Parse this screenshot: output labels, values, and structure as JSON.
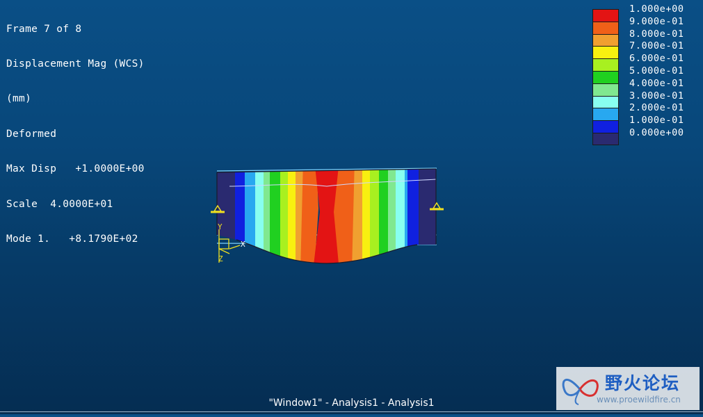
{
  "info_lines": [
    "Frame 7 of 8",
    "Displacement Mag (WCS)",
    "(mm)",
    "Deformed",
    "Max Disp   +1.0000E+00",
    "Scale  4.0000E+01",
    "Mode 1.   +8.1790E+02"
  ],
  "legend": [
    {
      "label": "1.000e+00",
      "color": "#e31414"
    },
    {
      "label": "9.000e-01",
      "color": "#f06018"
    },
    {
      "label": "8.000e-01",
      "color": "#f0a030"
    },
    {
      "label": "7.000e-01",
      "color": "#f8f010"
    },
    {
      "label": "6.000e-01",
      "color": "#a8f020"
    },
    {
      "label": "5.000e-01",
      "color": "#20d020"
    },
    {
      "label": "4.000e-01",
      "color": "#80e890"
    },
    {
      "label": "3.000e-01",
      "color": "#88fff0"
    },
    {
      "label": "2.000e-01",
      "color": "#28a8f0"
    },
    {
      "label": "1.000e-01",
      "color": "#1020e0"
    },
    {
      "label": "0.000e+00",
      "color": "#2a2a70"
    }
  ],
  "axes": {
    "y": "Y",
    "x": "X",
    "z": "Z"
  },
  "footer": "\"Window1\" - Analysis1 - Analysis1",
  "watermark": {
    "title": "野火论坛",
    "url": "www.proewildfire.cn"
  }
}
